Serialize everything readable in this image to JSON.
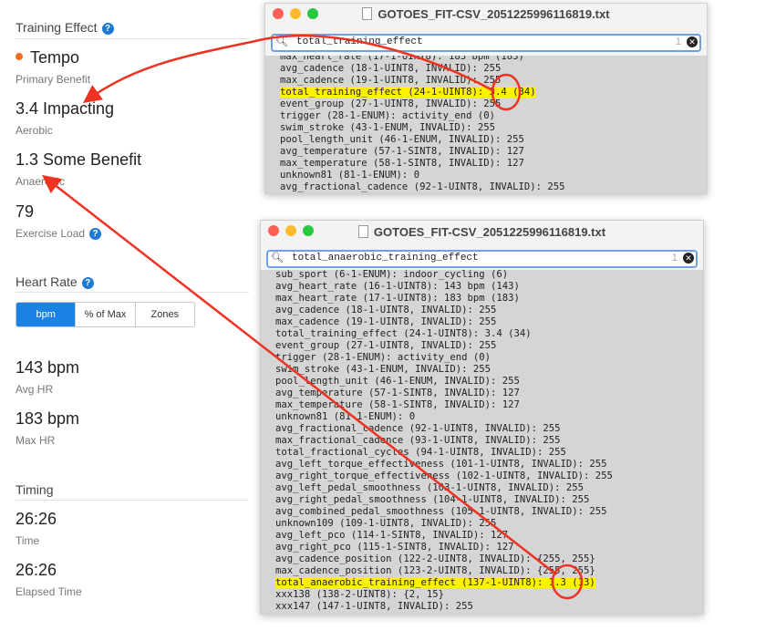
{
  "training_effect": {
    "title": "Training Effect",
    "help": "?",
    "primary_value": "Tempo",
    "primary_label": "Primary Benefit",
    "aerobic_value": "3.4 Impacting",
    "aerobic_label": "Aerobic",
    "anaerobic_value": "1.3 Some Benefit",
    "anaerobic_label": "Anaerobic",
    "load_value": "79",
    "load_label": "Exercise Load"
  },
  "heart_rate": {
    "title": "Heart Rate",
    "tabs": [
      "bpm",
      "% of Max",
      "Zones"
    ],
    "avg_value": "143 bpm",
    "avg_label": "Avg HR",
    "max_value": "183 bpm",
    "max_label": "Max HR"
  },
  "timing": {
    "title": "Timing",
    "time_value": "26:26",
    "time_label": "Time",
    "elapsed_value": "26:26",
    "elapsed_label": "Elapsed Time"
  },
  "window1": {
    "title": "GOTOES_FIT-CSV_2051225996116819.txt",
    "search": "total_training_effect",
    "count": "1",
    "lines": [
      "max_heart_rate (17-1-UINT8): 183 bpm (183)",
      "avg_cadence (18-1-UINT8, INVALID): 255",
      "max_cadence (19-1-UINT8, INVALID): 255",
      "total_training_effect (24-1-UINT8): 3.4 (34)",
      "event_group (27-1-UINT8, INVALID): 255",
      "trigger (28-1-ENUM): activity_end (0)",
      "swim_stroke (43-1-ENUM, INVALID): 255",
      "pool_length_unit (46-1-ENUM, INVALID): 255",
      "avg_temperature (57-1-SINT8, INVALID): 127",
      "max_temperature (58-1-SINT8, INVALID): 127",
      "unknown81 (81-1-ENUM): 0",
      "avg_fractional_cadence (92-1-UINT8, INVALID): 255"
    ]
  },
  "window2": {
    "title": "GOTOES_FIT-CSV_2051225996116819.txt",
    "search": "total_anaerobic_training_effect",
    "count": "1",
    "lines": [
      "sub_sport (6-1-ENUM): indoor_cycling (6)",
      "avg_heart_rate (16-1-UINT8): 143 bpm (143)",
      "max_heart_rate (17-1-UINT8): 183 bpm (183)",
      "avg_cadence (18-1-UINT8, INVALID): 255",
      "max_cadence (19-1-UINT8, INVALID): 255",
      "total_training_effect (24-1-UINT8): 3.4 (34)",
      "event_group (27-1-UINT8, INVALID): 255",
      "trigger (28-1-ENUM): activity_end (0)",
      "swim_stroke (43-1-ENUM, INVALID): 255",
      "pool_length_unit (46-1-ENUM, INVALID): 255",
      "avg_temperature (57-1-SINT8, INVALID): 127",
      "max_temperature (58-1-SINT8, INVALID): 127",
      "unknown81 (81-1-ENUM): 0",
      "avg_fractional_cadence (92-1-UINT8, INVALID): 255",
      "max_fractional_cadence (93-1-UINT8, INVALID): 255",
      "total_fractional_cycles (94-1-UINT8, INVALID): 255",
      "avg_left_torque_effectiveness (101-1-UINT8, INVALID): 255",
      "avg_right_torque_effectiveness (102-1-UINT8, INVALID): 255",
      "avg_left_pedal_smoothness (103-1-UINT8, INVALID): 255",
      "avg_right_pedal_smoothness (104-1-UINT8, INVALID): 255",
      "avg_combined_pedal_smoothness (105-1-UINT8, INVALID): 255",
      "unknown109 (109-1-UINT8, INVALID): 255",
      "avg_left_pco (114-1-SINT8, INVALID): 127",
      "avg_right_pco (115-1-SINT8, INVALID): 127",
      "avg_cadence_position (122-2-UINT8, INVALID): {255, 255}",
      "max_cadence_position (123-2-UINT8, INVALID): {255, 255}",
      "total_anaerobic_training_effect (137-1-UINT8): 1.3 (13)",
      "xxx138 (138-2-UINT8): {2, 15}",
      "xxx147 (147-1-UINT8, INVALID): 255"
    ]
  },
  "colors": {
    "annotation": "#ee3322",
    "accent": "#1a82e2",
    "tempo_dot": "#f26c21",
    "highlight": "#fff200"
  }
}
